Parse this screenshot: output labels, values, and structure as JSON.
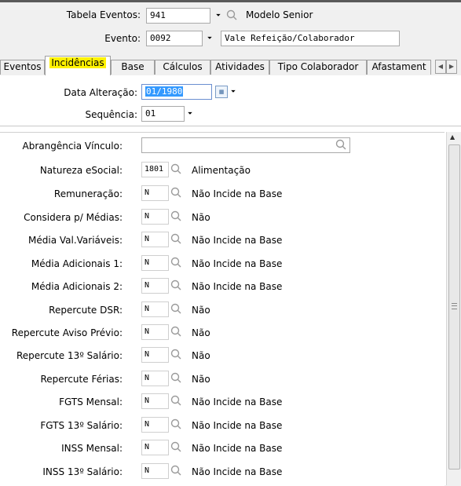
{
  "header": {
    "tabela_eventos_label": "Tabela Eventos:",
    "tabela_eventos_value": "941",
    "tabela_eventos_desc": "Modelo Senior",
    "evento_label": "Evento:",
    "evento_value": "0092",
    "evento_desc": "Vale Refeição/Colaborador"
  },
  "tabs": [
    {
      "label": "Eventos"
    },
    {
      "label": "Incidências"
    },
    {
      "label": "Base"
    },
    {
      "label": "Cálculos"
    },
    {
      "label": "Atividades"
    },
    {
      "label": "Tipo Colaborador"
    },
    {
      "label": "Afastament"
    }
  ],
  "upper_form": {
    "data_alteracao_label": "Data Alteração:",
    "data_alteracao_value": "01/1980",
    "sequencia_label": "Sequência:",
    "sequencia_value": "01"
  },
  "list": {
    "abrangencia_label": "Abrangência Vínculo:",
    "rows": [
      {
        "label": "Natureza eSocial:",
        "code": "1801",
        "desc": "Alimentação"
      },
      {
        "label": "Remuneração:",
        "code": "N",
        "desc": "Não Incide na Base"
      },
      {
        "label": "Considera p/ Médias:",
        "code": "N",
        "desc": "Não"
      },
      {
        "label": "Média Val.Variáveis:",
        "code": "N",
        "desc": "Não Incide na Base"
      },
      {
        "label": "Média Adicionais 1:",
        "code": "N",
        "desc": "Não Incide na Base"
      },
      {
        "label": "Média Adicionais 2:",
        "code": "N",
        "desc": "Não Incide na Base"
      },
      {
        "label": "Repercute DSR:",
        "code": "N",
        "desc": "Não"
      },
      {
        "label": "Repercute Aviso Prévio:",
        "code": "N",
        "desc": "Não"
      },
      {
        "label": "Repercute 13º Salário:",
        "code": "N",
        "desc": "Não"
      },
      {
        "label": "Repercute Férias:",
        "code": "N",
        "desc": "Não"
      },
      {
        "label": "FGTS Mensal:",
        "code": "N",
        "desc": "Não Incide na Base"
      },
      {
        "label": "FGTS 13º Salário:",
        "code": "N",
        "desc": "Não Incide na Base"
      },
      {
        "label": "INSS Mensal:",
        "code": "N",
        "desc": "Não Incide na Base"
      },
      {
        "label": "INSS 13º Salário:",
        "code": "N",
        "desc": "Não Incide na Base"
      }
    ]
  },
  "icons": {
    "lookup": "search-icon",
    "dropdown": "chevron-down-icon",
    "calendar": "calendar-icon",
    "scroll": "scrollbar-grip-icon"
  },
  "colors": {
    "active_tab_highlight": "#fff200",
    "selection": "#3399ff",
    "border": "#a9a9a9"
  }
}
